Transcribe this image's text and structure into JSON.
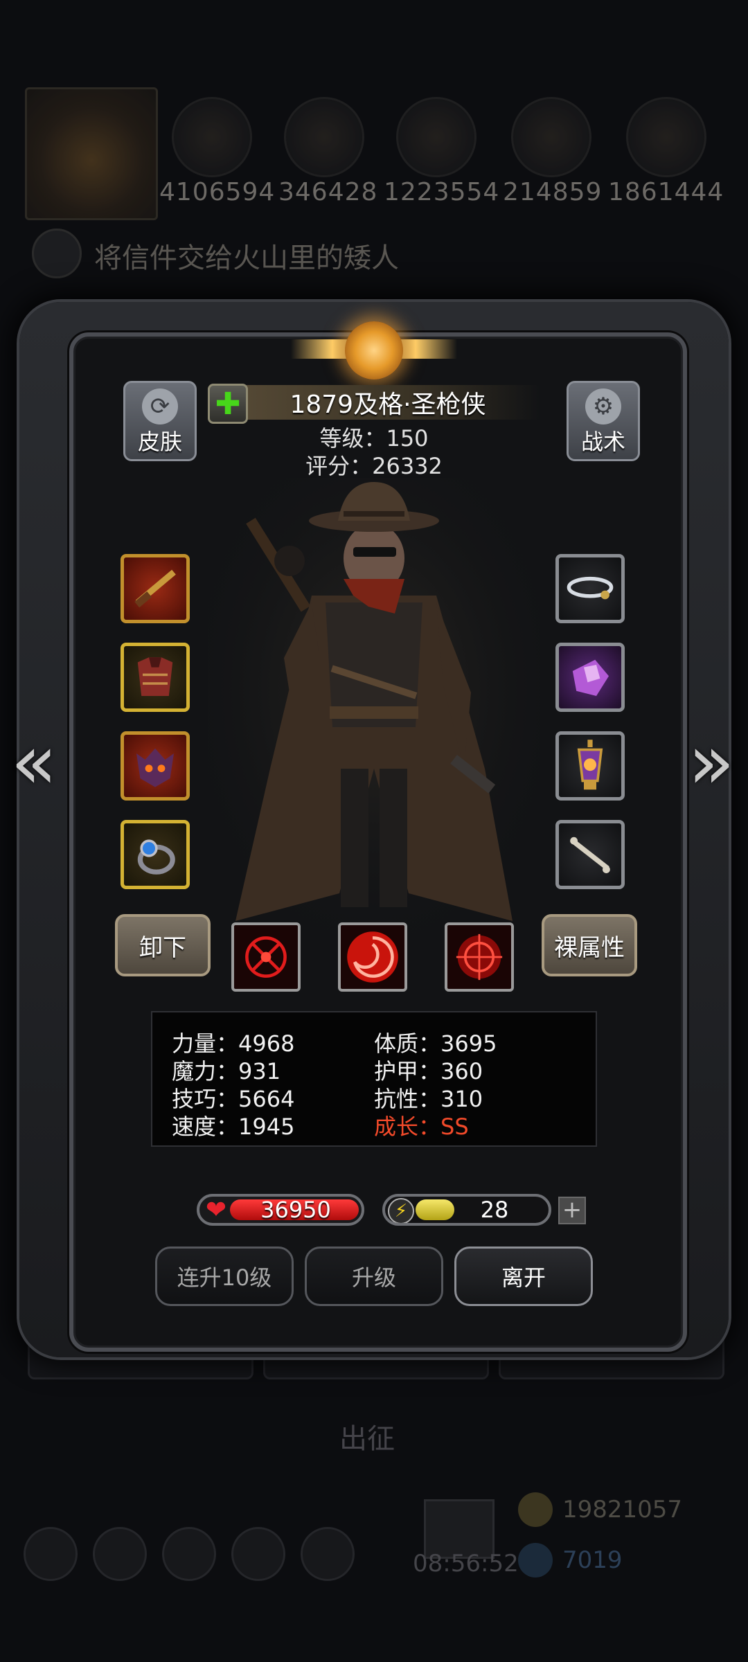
{
  "background": {
    "resources": [
      "4106594",
      "346428",
      "1223554",
      "214859",
      "1861444"
    ],
    "quest": "将信件交给火山里的矮人",
    "sortie": "出征",
    "time": "08:56:52",
    "coins": "19821057",
    "gems": "7019"
  },
  "header": {
    "skin_label": "皮肤",
    "tactic_label": "战术",
    "hero_name": "1879及格·圣枪侠",
    "level_text": "等级：150",
    "score_text": "评分：26332"
  },
  "equipment": {
    "left": [
      "rifle-icon",
      "armor-icon",
      "demon-mask-icon",
      "sapphire-ring-icon"
    ],
    "right": [
      "cloud-amulet-icon",
      "purple-crystal-icon",
      "lantern-icon",
      "bone-icon"
    ]
  },
  "actions": {
    "unequip": "卸下",
    "bare_attributes": "裸属性"
  },
  "stats": {
    "strength": "力量：4968",
    "magic": "魔力：931",
    "skill": "技巧：5664",
    "speed": "速度：1945",
    "constitution": "体质：3695",
    "armor": "护甲：360",
    "resistance": "抗性：310",
    "growth": "成长：SS"
  },
  "bars": {
    "hp": "36950",
    "energy": "28",
    "energy_fill": 0.3
  },
  "buttons": {
    "level_up_10": "连升10级",
    "level_up": "升级",
    "leave": "离开"
  },
  "colors": {
    "growth": "#f24a2a",
    "hp": "#d11a1a",
    "energy": "#e0d03a"
  }
}
